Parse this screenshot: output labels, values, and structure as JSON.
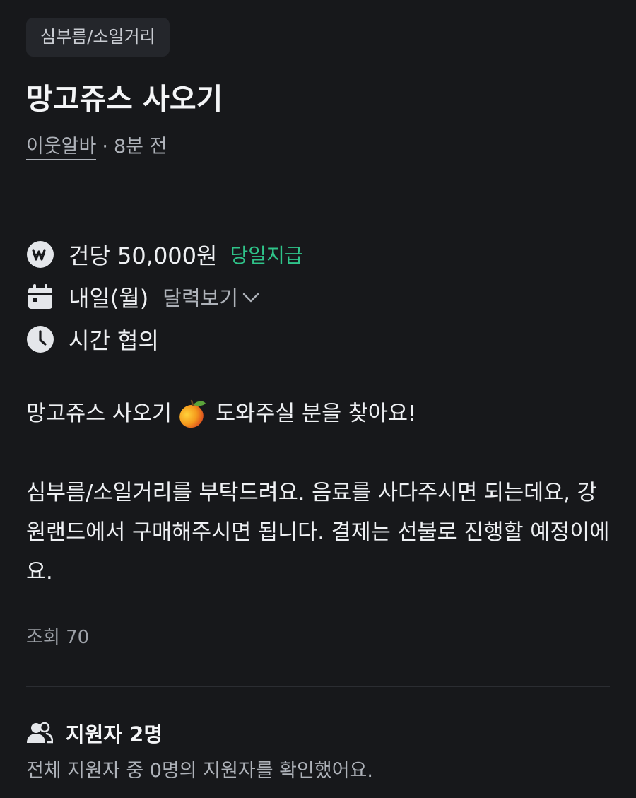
{
  "category_tag": "심부름/소일거리",
  "post": {
    "title": "망고쥬스 사오기",
    "author": "이웃알바",
    "time_ago": "8분 전"
  },
  "info": {
    "pay": "건당 50,000원",
    "pay_badge": "당일지급",
    "date": "내일(월)",
    "calendar_link": "달력보기",
    "time": "시간 협의"
  },
  "description": {
    "line1_before": "망고쥬스 사오기",
    "line1_after": "도와주실 분을 찾아요!",
    "body": "심부름/소일거리를 부탁드려요. 음료를 사다주시면 되는데요, 강원랜드에서 구매해주시면 됩니다. 결제는 선불로 진행할 예정이에요."
  },
  "views": "조회 70",
  "applicants": {
    "title": "지원자 2명",
    "subtitle": "전체 지원자 중 0명의 지원자를 확인했어요."
  },
  "colors": {
    "background": "#17181b",
    "accent_green": "#2fc48a",
    "muted_text": "#aeb2b9"
  },
  "icons": {
    "pay": "won-coin-icon",
    "date": "calendar-icon",
    "time": "clock-icon",
    "calendar_link": "chevron-down-icon",
    "emoji": "mango-emoji-icon",
    "applicants": "people-icon"
  }
}
